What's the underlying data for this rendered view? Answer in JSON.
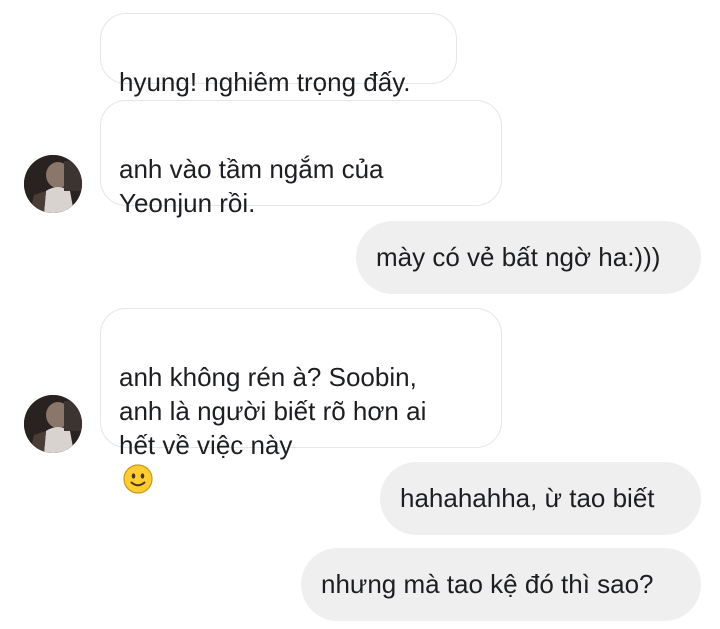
{
  "messages": [
    {
      "from": "them",
      "text": "hyung! nghiêm trọng đấy."
    },
    {
      "from": "them",
      "text": "anh vào tầm ngắm của\nYeonjun rồi."
    },
    {
      "from": "me",
      "text": "mày có vẻ bất ngờ ha:)))"
    },
    {
      "from": "them",
      "text": "anh không rén à? Soobin,\nanh là người biết rõ hơn ai\nhết về việc này",
      "emoji": "slightly-smiling-face-icon"
    },
    {
      "from": "me",
      "text": "hahahahha, ừ tao biết"
    },
    {
      "from": "me",
      "text": "nhưng mà tao kệ đó thì sao?"
    }
  ],
  "colors": {
    "incoming_bubble": "#ffffff",
    "incoming_border": "#e4e6e9",
    "outgoing_bubble": "#efefef",
    "text": "#1c1e21"
  }
}
